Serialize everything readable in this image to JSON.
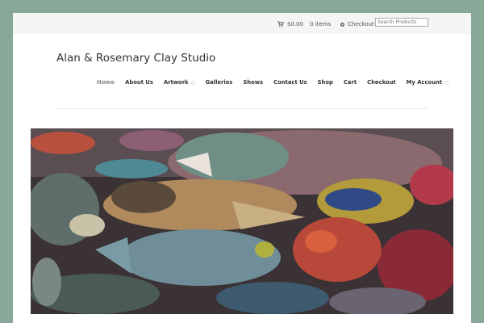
{
  "topbar": {
    "cart_total": "$0.00",
    "cart_items": "0 items",
    "checkout_label": "Checkout",
    "search_placeholder": "Search Products"
  },
  "site_title": "Alan & Rosemary Clay Studio",
  "nav": {
    "items": [
      {
        "label": "Home",
        "active": true
      },
      {
        "label": "About Us"
      },
      {
        "label": "Artwork",
        "has_submenu": true
      },
      {
        "label": "Galleries"
      },
      {
        "label": "Shows"
      },
      {
        "label": "Contact Us"
      },
      {
        "label": "Shop"
      },
      {
        "label": "Cart"
      },
      {
        "label": "Checkout"
      },
      {
        "label": "My Account",
        "has_submenu": true
      }
    ]
  },
  "hero": {
    "icon": "ceramic-fish-photo"
  },
  "colors": {
    "background": "#88a898",
    "topbar": "#f5f5f5",
    "text": "#333333",
    "nav_active": "#888888"
  }
}
